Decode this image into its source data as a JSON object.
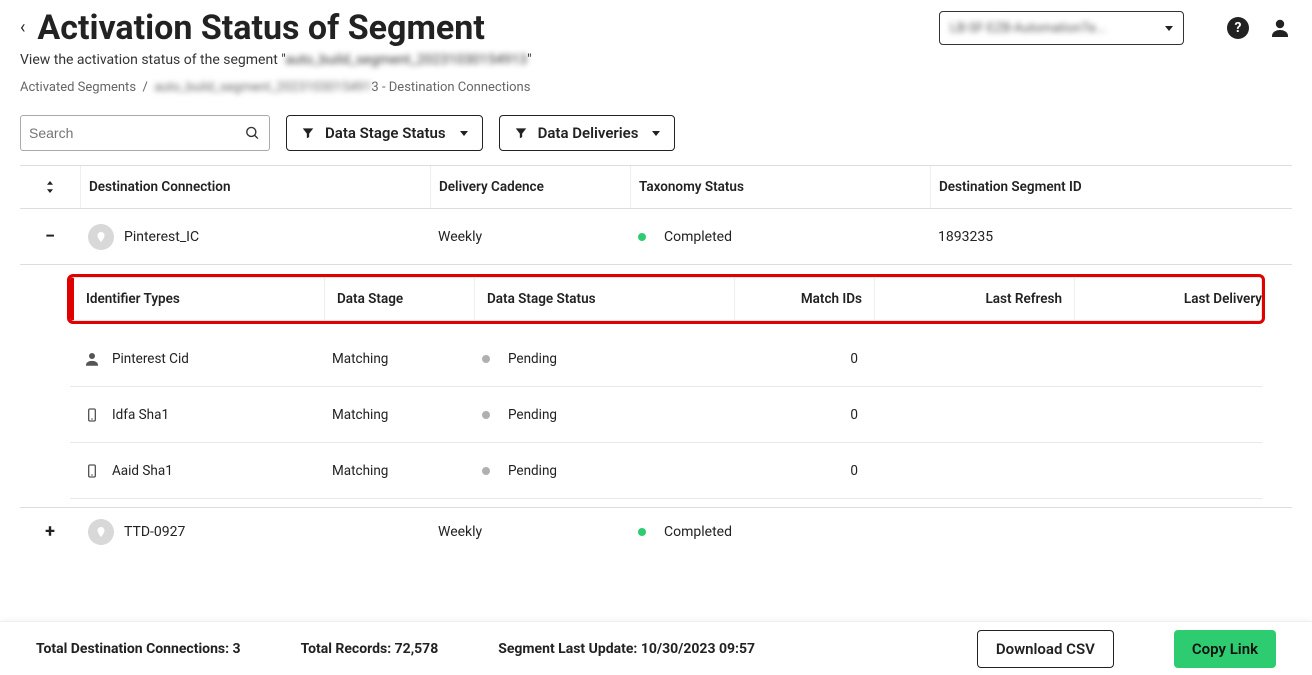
{
  "header": {
    "title": "Activation Status of Segment",
    "subtitle_prefix": "View the activation status of the segment \"",
    "subtitle_blurred": "auto_build_segment_20231030154913",
    "subtitle_suffix": "\"",
    "org_blurred": "LB-SF-EZB-AutomationTe..."
  },
  "breadcrumb": {
    "activated_segments": "Activated Segments",
    "sep": "/",
    "blurred": "auto_build_segment_2023103015491",
    "tail": "3 - Destination Connections"
  },
  "toolbar": {
    "search_placeholder": "Search",
    "filter1": "Data Stage Status",
    "filter2": "Data Deliveries"
  },
  "columns": {
    "c1": "Destination Connection",
    "c2": "Delivery Cadence",
    "c3": "Taxonomy Status",
    "c4": "Destination Segment ID"
  },
  "sub_columns": {
    "s1": "Identifier Types",
    "s2": "Data Stage",
    "s3": "Data Stage Status",
    "s4": "Match IDs",
    "s5": "Last Refresh",
    "s6": "Last Delivery"
  },
  "rows": [
    {
      "expand": "−",
      "name": "Pinterest_IC",
      "cadence": "Weekly",
      "status": "Completed",
      "status_dot": "green",
      "segment_id": "1893235",
      "sub": [
        {
          "icon": "person",
          "id_type": "Pinterest Cid",
          "stage": "Matching",
          "stage_status": "Pending",
          "match_ids": "0",
          "last_refresh": "",
          "last_delivery": ""
        },
        {
          "icon": "phone",
          "id_type": "Idfa Sha1",
          "stage": "Matching",
          "stage_status": "Pending",
          "match_ids": "0",
          "last_refresh": "",
          "last_delivery": ""
        },
        {
          "icon": "phone",
          "id_type": "Aaid Sha1",
          "stage": "Matching",
          "stage_status": "Pending",
          "match_ids": "0",
          "last_refresh": "",
          "last_delivery": ""
        }
      ]
    },
    {
      "expand": "+",
      "name": "TTD-0927",
      "cadence": "Weekly",
      "status": "Completed",
      "status_dot": "green",
      "segment_id": ""
    }
  ],
  "footer": {
    "total_conn_label": "Total Destination Connections: ",
    "total_conn_value": "3",
    "total_records_label": "Total Records: ",
    "total_records_value": "72,578",
    "last_update_label": "Segment Last Update: ",
    "last_update_value": "10/30/2023 09:57",
    "download": "Download CSV",
    "copy_link": "Copy Link"
  }
}
